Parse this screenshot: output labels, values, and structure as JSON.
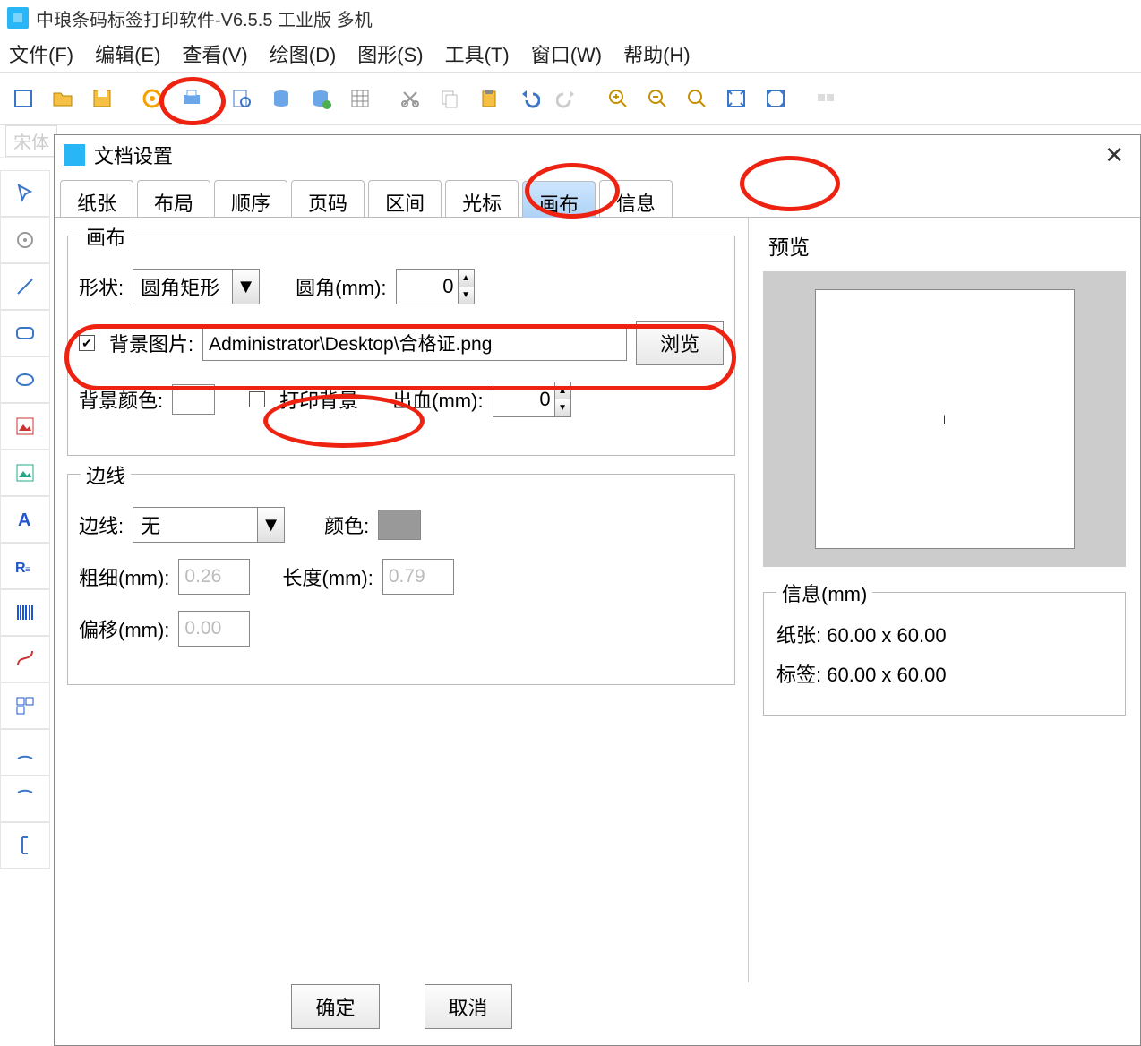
{
  "app": {
    "title": "中琅条码标签打印软件-V6.5.5 工业版 多机"
  },
  "menubar": [
    "文件(F)",
    "编辑(E)",
    "查看(V)",
    "绘图(D)",
    "图形(S)",
    "工具(T)",
    "窗口(W)",
    "帮助(H)"
  ],
  "fontcombo": "宋体",
  "dialog": {
    "title": "文档设置",
    "tabs": [
      "纸张",
      "布局",
      "顺序",
      "页码",
      "区间",
      "光标",
      "画布",
      "信息"
    ],
    "active_tab": 6,
    "preview_label": "预览",
    "canvas_group": "画布",
    "shape_label": "形状:",
    "shape_value": "圆角矩形",
    "corner_label": "圆角(mm):",
    "corner_value": "0",
    "bgimg_label": "背景图片:",
    "bgimg_checked": true,
    "bgimg_path": "Administrator\\Desktop\\合格证.png",
    "browse_btn": "浏览",
    "bgcolor_label": "背景颜色:",
    "printbg_label": "打印背景",
    "printbg_checked": false,
    "bleed_label": "出血(mm):",
    "bleed_value": "0",
    "border_group": "边线",
    "border_label": "边线:",
    "border_value": "无",
    "color_label": "颜色:",
    "thick_label": "粗细(mm):",
    "thick_value": "0.26",
    "len_label": "长度(mm):",
    "len_value": "0.79",
    "offset_label": "偏移(mm):",
    "offset_value": "0.00",
    "info_group": "信息(mm)",
    "info_paper_label": "纸张:",
    "info_paper_value": "60.00 x 60.00",
    "info_label_label": "标签:",
    "info_label_value": "60.00 x 60.00",
    "ok": "确定",
    "cancel": "取消"
  }
}
